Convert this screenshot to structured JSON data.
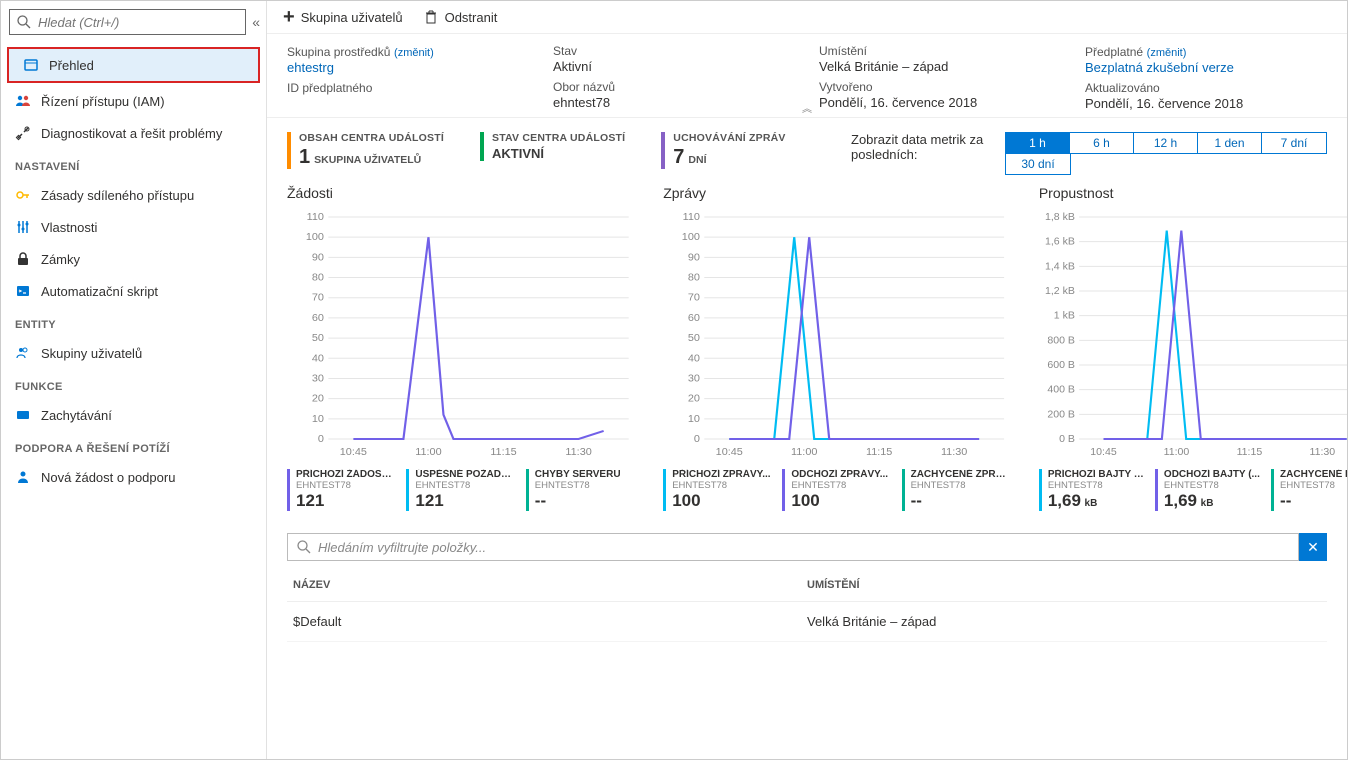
{
  "search": {
    "placeholder": "Hledat (Ctrl+/)"
  },
  "sidebar": {
    "items": [
      {
        "label": "Přehled"
      },
      {
        "label": "Řízení přístupu (IAM)"
      },
      {
        "label": "Diagnostikovat a řešit problémy"
      }
    ],
    "sections": {
      "nastaveni": {
        "title": "NASTAVENÍ",
        "items": [
          {
            "label": "Zásady sdíleného přístupu"
          },
          {
            "label": "Vlastnosti"
          },
          {
            "label": "Zámky"
          },
          {
            "label": "Automatizační skript"
          }
        ]
      },
      "entity": {
        "title": "ENTITY",
        "items": [
          {
            "label": "Skupiny uživatelů"
          }
        ]
      },
      "funkce": {
        "title": "FUNKCE",
        "items": [
          {
            "label": "Zachytávání"
          }
        ]
      },
      "podpora": {
        "title": "PODPORA A ŘEŠENÍ POTÍŽÍ",
        "items": [
          {
            "label": "Nová žádost o podporu"
          }
        ]
      }
    }
  },
  "toolbar": {
    "addGroup": "Skupina uživatelů",
    "delete": "Odstranit"
  },
  "essentials": {
    "rg_label": "Skupina prostředků",
    "rg_change": "(změnit)",
    "rg_value": "ehtestrg",
    "sub_id_label": "ID předplatného",
    "status_label": "Stav",
    "status_value": "Aktivní",
    "ns_label": "Obor názvů",
    "ns_value": "ehntest78",
    "loc_label": "Umístění",
    "loc_value": "Velká Británie – západ",
    "created_label": "Vytvořeno",
    "created_value": "Pondělí, 16. července 2018",
    "sub_label": "Předplatné",
    "sub_change": "(změnit)",
    "sub_value": "Bezplatná zkušební verze",
    "updated_label": "Aktualizováno",
    "updated_value": "Pondělí, 16. července 2018"
  },
  "counters": {
    "c1_label": "OBSAH CENTRA UDÁLOSTÍ",
    "c1_num": "1",
    "c1_unit": "SKUPINA UŽIVATELŮ",
    "c2_label": "STAV CENTRA UDÁLOSTÍ",
    "c2_val": "AKTIVNÍ",
    "c3_label": "UCHOVÁVÁNÍ ZPRÁV",
    "c3_num": "7",
    "c3_unit": "DNÍ"
  },
  "timerange": {
    "label": "Zobrazit data metrik za posledních:",
    "options": [
      "1 h",
      "6 h",
      "12 h",
      "1 den",
      "7 dní",
      "30 dní"
    ],
    "active": "1 h"
  },
  "charts": {
    "c1_title": "Žádosti",
    "c2_title": "Zprávy",
    "c3_title": "Propustnost"
  },
  "chart_data": [
    {
      "type": "line",
      "title": "Žádosti",
      "x_ticks": [
        "10:45",
        "11:00",
        "11:15",
        "11:30"
      ],
      "y_ticks": [
        0,
        10,
        20,
        30,
        40,
        50,
        60,
        70,
        80,
        90,
        100,
        110
      ],
      "ylim": [
        0,
        110
      ],
      "series": [
        {
          "name": "PŘÍCHOZÍ ŽÁDOSTI...",
          "color": "#7160e8",
          "x": [
            "10:45",
            "10:55",
            "11:00",
            "11:03",
            "11:05",
            "11:30",
            "11:35"
          ],
          "values": [
            0,
            0,
            100,
            12,
            0,
            0,
            4
          ]
        },
        {
          "name": "ÚSPĚŠNÉ POŽADAVKY",
          "color": "#00bcf2",
          "x": [
            "10:45",
            "10:55",
            "11:00",
            "11:03",
            "11:05",
            "11:30",
            "11:35"
          ],
          "values": [
            0,
            0,
            100,
            12,
            0,
            0,
            4
          ]
        }
      ],
      "legend": [
        {
          "title": "PŘÍCHOZÍ ŽÁDOSTI...",
          "sub": "EHNTEST78",
          "value": "121",
          "color": "purple"
        },
        {
          "title": "ÚSPĚŠNÉ POŽADAVKY",
          "sub": "EHNTEST78",
          "value": "121",
          "color": "cyan"
        },
        {
          "title": "CHYBY SERVERU",
          "sub": "EHNTEST78",
          "value": "--",
          "color": "teal"
        }
      ]
    },
    {
      "type": "line",
      "title": "Zprávy",
      "x_ticks": [
        "10:45",
        "11:00",
        "11:15",
        "11:30"
      ],
      "y_ticks": [
        0,
        10,
        20,
        30,
        40,
        50,
        60,
        70,
        80,
        90,
        100,
        110
      ],
      "ylim": [
        0,
        110
      ],
      "series": [
        {
          "name": "PŘÍCHOZÍ ZPRÁVY...",
          "color": "#00bcf2",
          "x": [
            "10:45",
            "10:54",
            "10:58",
            "11:02",
            "11:35"
          ],
          "values": [
            0,
            0,
            100,
            0,
            0
          ]
        },
        {
          "name": "ODCHOZÍ ZPRÁVY...",
          "color": "#7160e8",
          "x": [
            "10:45",
            "10:57",
            "11:01",
            "11:05",
            "11:35"
          ],
          "values": [
            0,
            0,
            100,
            0,
            0
          ]
        }
      ],
      "legend": [
        {
          "title": "PŘÍCHOZÍ ZPRÁVY...",
          "sub": "EHNTEST78",
          "value": "100",
          "color": "cyan"
        },
        {
          "title": "ODCHOZÍ ZPRÁVY...",
          "sub": "EHNTEST78",
          "value": "100",
          "color": "purple"
        },
        {
          "title": "ZACHYCENÉ ZPRÁVY",
          "sub": "EHNTEST78",
          "value": "--",
          "color": "teal"
        }
      ]
    },
    {
      "type": "line",
      "title": "Propustnost",
      "x_ticks": [
        "10:45",
        "11:00",
        "11:15",
        "11:30"
      ],
      "y_ticks_labels": [
        "0 B",
        "200 B",
        "400 B",
        "600 B",
        "800 B",
        "1 kB",
        "1,2 kB",
        "1,4 kB",
        "1,6 kB",
        "1,8 kB"
      ],
      "ylim_bytes": [
        0,
        1800
      ],
      "series": [
        {
          "name": "PŘÍCHOZÍ BAJTY (...",
          "color": "#00bcf2",
          "x": [
            "10:45",
            "10:54",
            "10:58",
            "11:02",
            "11:35"
          ],
          "values_bytes": [
            0,
            0,
            1690,
            0,
            0
          ]
        },
        {
          "name": "ODCHOZÍ BAJTY (...",
          "color": "#7160e8",
          "x": [
            "10:45",
            "10:57",
            "11:01",
            "11:05",
            "11:35"
          ],
          "values_bytes": [
            0,
            0,
            1690,
            0,
            0
          ]
        }
      ],
      "legend": [
        {
          "title": "PŘÍCHOZÍ BAJTY (...",
          "sub": "EHNTEST78",
          "value": "1,69",
          "unit": "kB",
          "color": "cyan"
        },
        {
          "title": "ODCHOZÍ BAJTY (...",
          "sub": "EHNTEST78",
          "value": "1,69",
          "unit": "kB",
          "color": "purple"
        },
        {
          "title": "ZACHYCENÉ BAJTY",
          "sub": "EHNTEST78",
          "value": "--",
          "color": "teal"
        }
      ]
    }
  ],
  "filter": {
    "placeholder": "Hledáním vyfiltrujte položky..."
  },
  "table": {
    "head_name": "NÁZEV",
    "head_loc": "UMÍSTĚNÍ",
    "rows": [
      {
        "name": "$Default",
        "loc": "Velká Británie – západ"
      }
    ]
  }
}
